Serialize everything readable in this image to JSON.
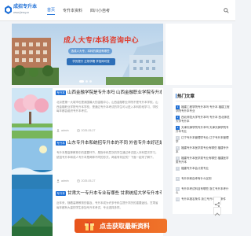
{
  "header": {
    "logo_text": "成招专升本",
    "logo_sub": "www.jiesq.cn",
    "nav": [
      {
        "label": "首页",
        "active": true
      },
      {
        "label": "专升本资料",
        "active": false
      },
      {
        "label": "四川小自考",
        "active": false
      }
    ]
  },
  "banner": {
    "title": "成人大专/本科咨询中心",
    "tag": "选成人大专、本科的原因有哪些",
    "tag2": "学历提升 正规学籍 学信网可查"
  },
  "articles": [
    {
      "badge": "专升本",
      "title": "山西金融学院是专升本吗 山西金融职业学院专升本吗",
      "excerpt": "北京是第一大城市也是我国最大的金融中心，山西金融职业学院不是专升本学校。山西金融职业学院专升本学校，是通过专升本考试的学生可以进入本科阶段学习，学校每年都会组织专升本考试。",
      "author": "admin",
      "date": "2025-05-27"
    },
    {
      "badge": "专升本",
      "title": "山东专升本和统招专升本的不同 外省专升本好还是本...",
      "excerpt": "专升本是高等教育中的重要环节，是指专科层次的学生通过考试进入本科层次学习。统招专升本和成人专升本是两种不同的形式，两者有何区别？下面一起来了解下。",
      "author": "admin",
      "date": "2025-05-27"
    },
    {
      "badge": "专升本",
      "title": "甘肃大一专升本专业有哪些 甘肃统招大学专升本专业有...",
      "excerpt": "近年来，随着高等教育的普及，专升本成为许多专科生提升学历的重要途径。甘肃省每年都有大量的学生参加专升本考试，专业选择多样。",
      "author": "admin",
      "date": "2025-05-27"
    }
  ],
  "hot": {
    "title": "热门文章",
    "items": [
      "福建工程学院专升本吗 专升本 福建工程学院专升本专业",
      "西北师范大学专升本吗 专升本 西北师范大学专升本",
      "天津天狮学院专升本吗 天津天狮学院专升本专业",
      "辽宁专升本管理学专业 辽宁专升本管理学",
      "福建专升本医学类专业有哪些 福建专升本",
      "福建专升本医学类专业有哪些 福建医学类专升本",
      "福建专升本会计类专业",
      "专升本和自考有什么区别",
      "专升本考试科目有哪些 浙江专升本考什么",
      "专升本报名条件 浙江专升本报考条件"
    ]
  },
  "float_bar": {
    "text": "点击获取最新资料"
  },
  "colors": {
    "accent": "#1e6fd6",
    "cta": "#e8541c",
    "banner_title": "#e03a2b"
  }
}
